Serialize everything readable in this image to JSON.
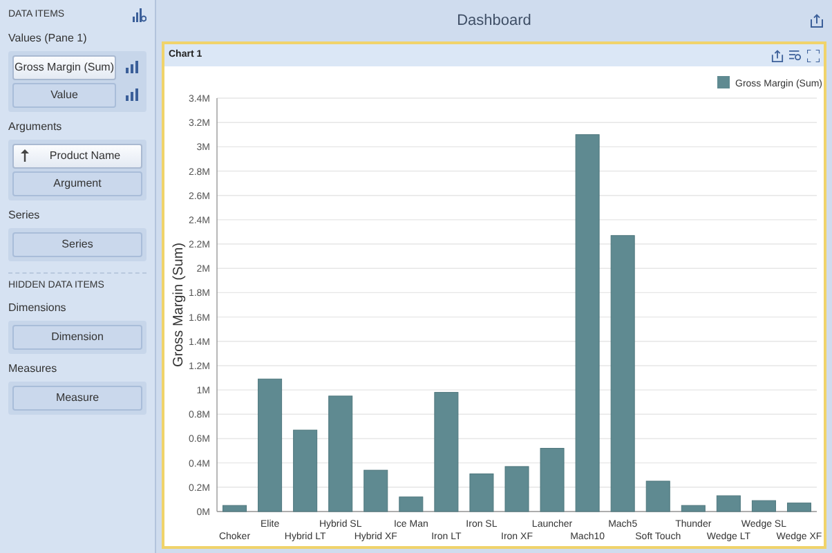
{
  "data_items_panel": {
    "title": "DATA ITEMS",
    "sections": [
      {
        "label": "Values (Pane 1)",
        "items": [
          {
            "label": "Gross Margin (Sum)",
            "kind": "measure"
          },
          {
            "label": "Value",
            "kind": "measure_placeholder"
          }
        ]
      },
      {
        "label": "Arguments",
        "items": [
          {
            "label": "Product Name",
            "kind": "dimension"
          },
          {
            "label": "Argument",
            "kind": "placeholder"
          }
        ]
      },
      {
        "label": "Series",
        "items": [
          {
            "label": "Series",
            "kind": "placeholder"
          }
        ]
      }
    ],
    "hidden_title": "HIDDEN DATA ITEMS",
    "hidden_sections": [
      {
        "label": "Dimensions",
        "items": [
          {
            "label": "Dimension",
            "kind": "placeholder"
          }
        ]
      },
      {
        "label": "Measures",
        "items": [
          {
            "label": "Measure",
            "kind": "placeholder"
          }
        ]
      }
    ]
  },
  "dashboard": {
    "title": "Dashboard",
    "chart_card": {
      "title": "Chart 1",
      "selected": true,
      "chart_data": {
        "type": "bar",
        "ylabel": "Gross Margin (Sum)",
        "categories": [
          "Choker",
          "Elite",
          "Hybrid LT",
          "Hybrid SL",
          "Hybrid XF",
          "Ice Man",
          "Iron LT",
          "Iron SL",
          "Iron XF",
          "Launcher",
          "Mach10",
          "Mach5",
          "Soft Touch",
          "Thunder",
          "Wedge LT",
          "Wedge SL",
          "Wedge XF"
        ],
        "series": [
          {
            "name": "Gross Margin (Sum)",
            "color": "#5f8a91",
            "values": [
              0.05,
              1.09,
              0.67,
              0.95,
              0.34,
              0.12,
              0.98,
              0.31,
              0.37,
              0.52,
              3.1,
              2.27,
              0.25,
              0.05,
              0.13,
              0.09,
              0.07
            ]
          }
        ],
        "ylim": [
          0,
          3.4
        ],
        "grid": true,
        "yticks": [
          {
            "value": 0,
            "label": "0M"
          },
          {
            "value": 0.2,
            "label": "0.2M"
          },
          {
            "value": 0.4,
            "label": "0.4M"
          },
          {
            "value": 0.6,
            "label": "0.6M"
          },
          {
            "value": 0.8,
            "label": "0.8M"
          },
          {
            "value": 1,
            "label": "1M"
          },
          {
            "value": 1.2,
            "label": "1.2M"
          },
          {
            "value": 1.4,
            "label": "1.4M"
          },
          {
            "value": 1.6,
            "label": "1.6M"
          },
          {
            "value": 1.8,
            "label": "1.8M"
          },
          {
            "value": 2,
            "label": "2M"
          },
          {
            "value": 2.2,
            "label": "2.2M"
          },
          {
            "value": 2.4,
            "label": "2.4M"
          },
          {
            "value": 2.6,
            "label": "2.6M"
          },
          {
            "value": 2.8,
            "label": "2.8M"
          },
          {
            "value": 3,
            "label": "3M"
          },
          {
            "value": 3.2,
            "label": "3.2M"
          },
          {
            "value": 3.4,
            "label": "3.4M"
          }
        ]
      }
    }
  }
}
